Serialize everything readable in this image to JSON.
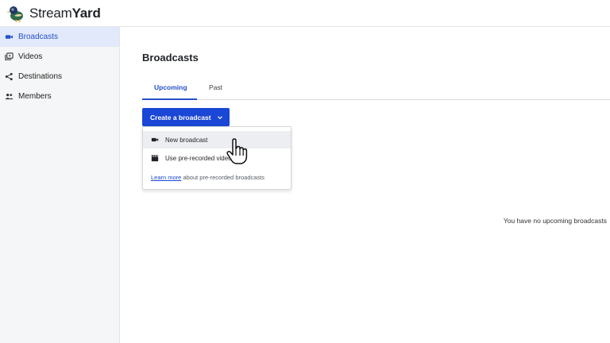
{
  "app": {
    "logo_text_regular": "Stream",
    "logo_text_bold": "Yard"
  },
  "sidebar": {
    "items": [
      {
        "label": "Broadcasts",
        "icon": "video-camera-icon",
        "active": true
      },
      {
        "label": "Videos",
        "icon": "video-library-icon",
        "active": false
      },
      {
        "label": "Destinations",
        "icon": "share-icon",
        "active": false
      },
      {
        "label": "Members",
        "icon": "people-icon",
        "active": false
      }
    ]
  },
  "main": {
    "title": "Broadcasts",
    "tabs": [
      {
        "label": "Upcoming",
        "active": true
      },
      {
        "label": "Past",
        "active": false
      }
    ],
    "create_button": {
      "label": "Create a broadcast",
      "icon": "chevron-down-icon"
    },
    "dropdown": {
      "items": [
        {
          "label": "New broadcast",
          "icon": "video-camera-icon",
          "hovered": true
        },
        {
          "label": "Use pre-recorded video",
          "icon": "clapperboard-icon",
          "hovered": false
        }
      ],
      "note_link": "Learn more",
      "note_text": " about pre-recorded broadcasts"
    },
    "empty_message": "You have no upcoming broadcasts"
  },
  "colors": {
    "accent": "#1b47d6",
    "active_nav_bg": "#e1e9fb",
    "active_text": "#2751c9",
    "sidebar_bg": "#f5f6f7"
  }
}
